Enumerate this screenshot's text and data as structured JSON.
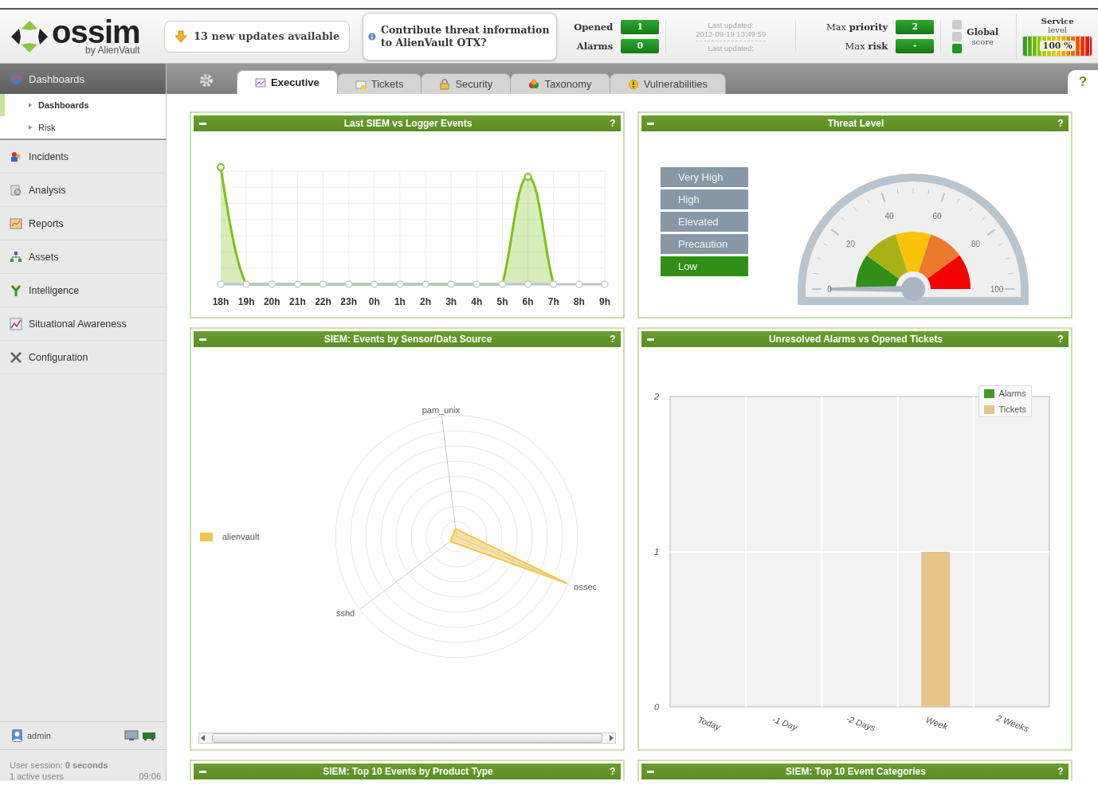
{
  "header": {
    "logo": {
      "name": "ossim",
      "byline": "by AlienVault"
    },
    "updates_button": "13 new updates available",
    "otx_prompt": "Contribute threat information to AlienVault OTX?",
    "counters": [
      {
        "label": "**Opened**",
        "value": "1"
      },
      {
        "label": "**Alarms**",
        "value": "0"
      }
    ],
    "last_updated": [
      "Last updated:",
      "2012-09-19 13:49:59",
      "Last updated:"
    ],
    "max": [
      {
        "label": "Max **priority**",
        "value": "2"
      },
      {
        "label": "Max **risk**",
        "value": "-"
      }
    ],
    "global_score": {
      "label": [
        "Global",
        "score"
      ],
      "lights": [
        {
          "on": false
        },
        {
          "on": false
        },
        {
          "on": true
        }
      ]
    },
    "service_level": {
      "label": [
        "Service",
        "level"
      ],
      "value": "100 %",
      "level": 1
    }
  },
  "sidebar": {
    "section": "Dashboards",
    "subitems": [
      {
        "label": "Dashboards",
        "selected": true
      },
      {
        "label": "Risk",
        "selected": false
      }
    ],
    "items": [
      {
        "label": "Incidents"
      },
      {
        "label": "Analysis"
      },
      {
        "label": "Reports"
      },
      {
        "label": "Assets"
      },
      {
        "label": "Intelligence"
      },
      {
        "label": "Situational Awareness"
      },
      {
        "label": "Configuration"
      }
    ],
    "user": "admin",
    "session": "User session: **0 seconds**",
    "active_users": "1 active users",
    "time": "09:06"
  },
  "tabs": [
    {
      "label": "Executive",
      "selected": true
    },
    {
      "label": "Tickets",
      "selected": false
    },
    {
      "label": "Security",
      "selected": false
    },
    {
      "label": "Taxonomy",
      "selected": false
    },
    {
      "label": "Vulnerabilities",
      "selected": false
    }
  ],
  "help": "?",
  "panels": [
    {
      "kind": "line",
      "title": "Last SIEM vs Logger Events",
      "x": [
        "18h",
        "19h",
        "20h",
        "21h",
        "22h",
        "23h",
        "0h",
        "1h",
        "2h",
        "3h",
        "4h",
        "5h",
        "6h",
        "7h",
        "8h",
        "9h"
      ]
    },
    {
      "kind": "threat",
      "title": "Threat Level",
      "levels": [
        {
          "label": "Very High",
          "selected": false
        },
        {
          "label": "High",
          "selected": false
        },
        {
          "label": "Elevated",
          "selected": false
        },
        {
          "label": "Precaution",
          "selected": false
        },
        {
          "label": "Low",
          "selected": true
        }
      ],
      "gauge": {
        "ticks": [
          "0",
          "20",
          "40",
          "60",
          "80",
          "100"
        ]
      }
    },
    {
      "kind": "radar",
      "title": "SIEM: Events by Sensor/Data Source",
      "legend": "alienvault",
      "axes": [
        "pam_unix",
        "ossec",
        "sshd"
      ]
    },
    {
      "kind": "bar",
      "title": "Unresolved Alarms vs Opened Tickets",
      "chart_data": {
        "type": "bar",
        "categories": [
          "Today",
          "-1 Day",
          "-2 Days",
          "Week",
          "2 Weeks"
        ],
        "series": [
          {
            "name": "Alarms",
            "color": "#3f9a2a",
            "values": [
              0,
              0,
              0,
              0,
              0
            ]
          },
          {
            "name": "Tickets",
            "color": "#e6c48a",
            "values": [
              0,
              0,
              0,
              1,
              0
            ]
          }
        ],
        "ylim": [
          0,
          2
        ],
        "yticks": [
          0,
          1,
          2
        ]
      }
    },
    {
      "kind": "empty",
      "title": "SIEM: Top 10 Events by Product Type"
    },
    {
      "kind": "empty",
      "title": "SIEM: Top 10 Event Categories"
    }
  ]
}
